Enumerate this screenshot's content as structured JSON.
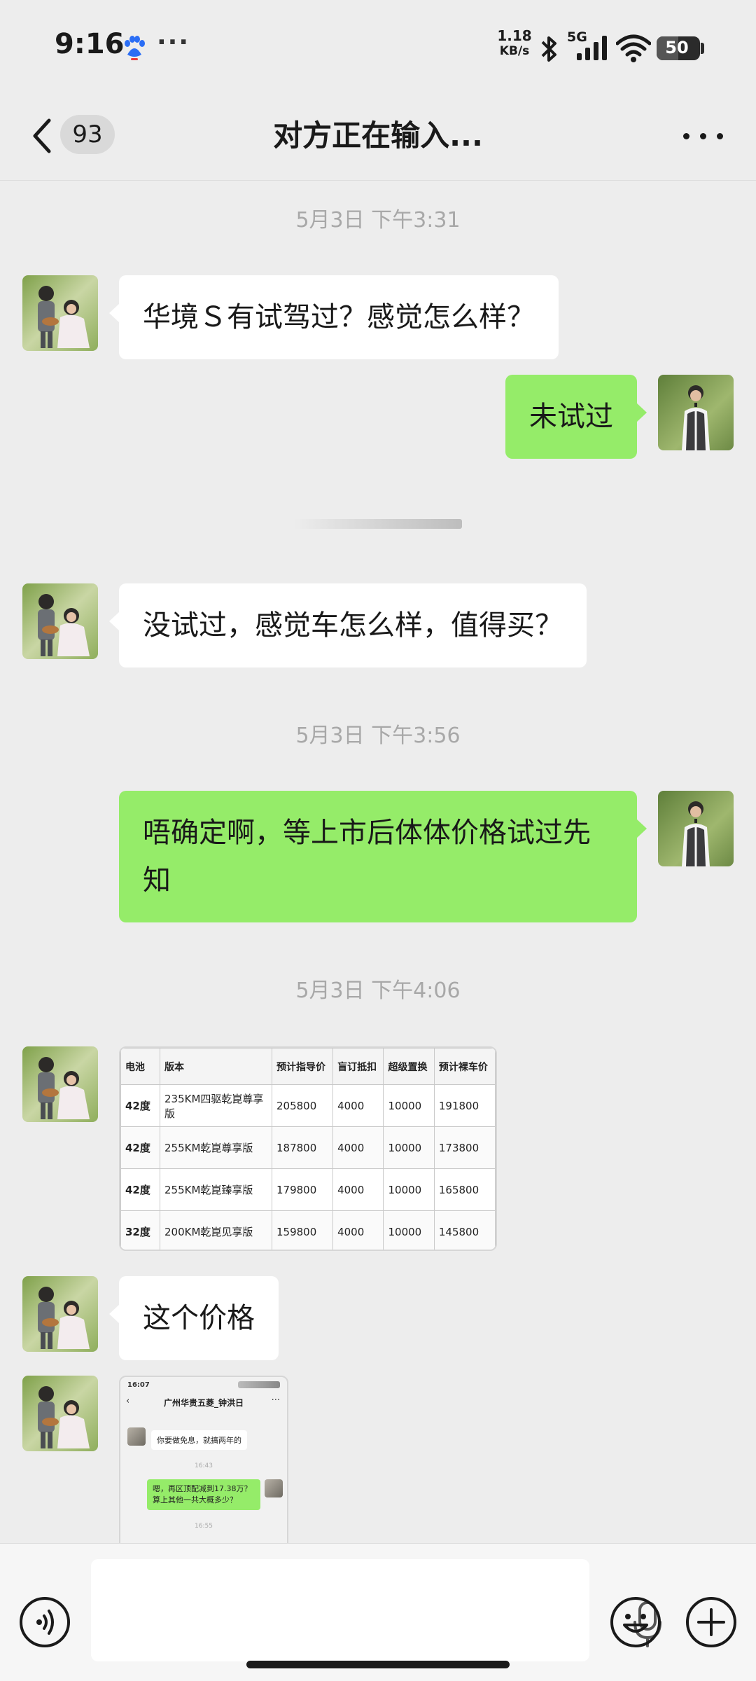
{
  "status_bar": {
    "time": "9:16",
    "more": "···",
    "net_speed": "1.18",
    "net_unit": "KB/s",
    "network": "5G",
    "battery": "50",
    "battery_fill_percent": 50,
    "icons": [
      "baidu-paw-icon",
      "bluetooth-icon",
      "signal-icon",
      "wifi-icon",
      "battery-icon"
    ]
  },
  "nav": {
    "unread_count": "93",
    "title": "对方正在输入...",
    "icons": [
      "back-chevron-icon",
      "more-dots-icon"
    ]
  },
  "messages": {
    "ts1": "5月3日 下午3:31",
    "m1": "华境Ｓ有试驾过？感觉怎么样？",
    "m2": "未试过",
    "m3": "没试过，感觉车怎么样，值得买？",
    "ts2": "5月3日 下午3:56",
    "m4": "唔确定啊，等上市后体体价格试过先知",
    "ts3": "5月3日 下午4:06",
    "m6": "这个价格"
  },
  "price_table": {
    "headers": [
      "电池",
      "版本",
      "预计指导价",
      "盲订抵扣",
      "超级置换",
      "预计裸车价"
    ],
    "rows": [
      [
        "42度",
        "235KM四驱乾崑尊享版",
        "205800",
        "4000",
        "10000",
        "191800"
      ],
      [
        "42度",
        "255KM乾崑尊享版",
        "187800",
        "4000",
        "10000",
        "173800"
      ],
      [
        "42度",
        "255KM乾崑臻享版",
        "179800",
        "4000",
        "10000",
        "165800"
      ],
      [
        "32度",
        "200KM乾崑见享版",
        "159800",
        "4000",
        "10000",
        "145800"
      ]
    ]
  },
  "screenshot_thumb": {
    "time": "16:07",
    "title": "广州华贵五菱_钟洪日",
    "msg_in": "你要做免息，就搞两年的",
    "ts_a": "16:43",
    "msg_out": "嗯，再区顶配减到17.38万？算上其他一共大概多少？",
    "ts_b": "16:55"
  },
  "input_bar": {
    "icons": [
      "voice-icon",
      "mic-icon",
      "emoji-icon",
      "plus-icon"
    ]
  },
  "colors": {
    "background": "#ededed",
    "incoming_bubble": "#ffffff",
    "outgoing_bubble": "#95ec69",
    "timestamp": "#a8a8a8"
  }
}
